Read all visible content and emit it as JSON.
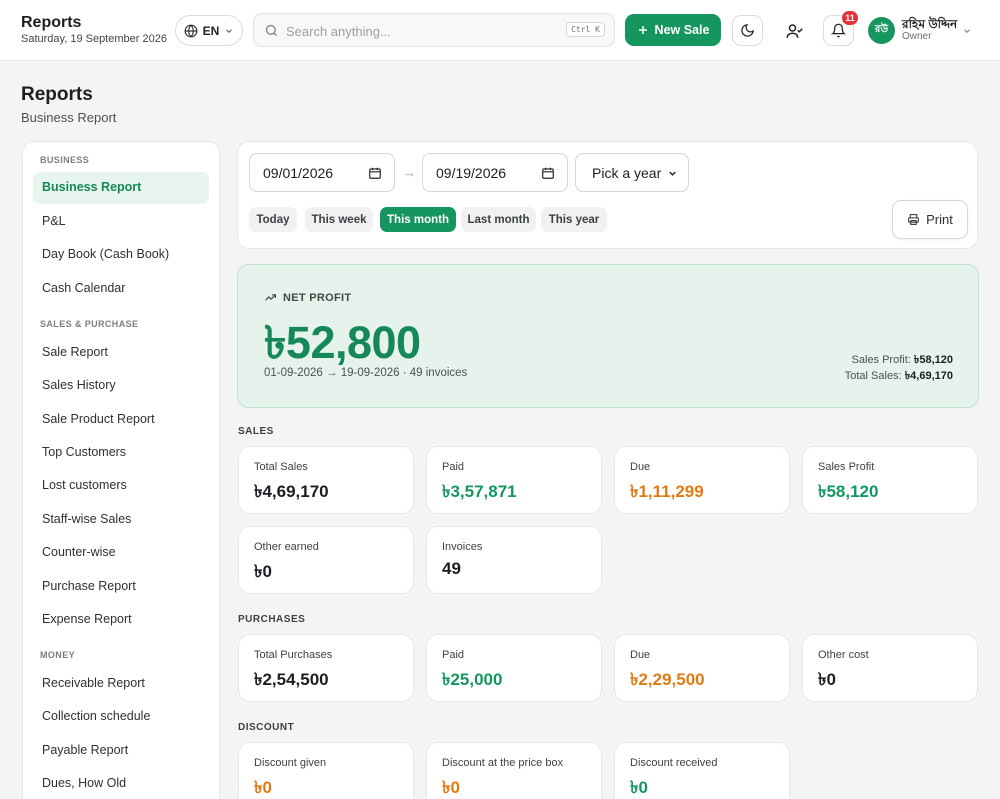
{
  "header": {
    "title": "Reports",
    "date": "Saturday, 19 September 2026",
    "language": "EN",
    "search_placeholder": "Search anything...",
    "search_shortcut": "Ctrl K",
    "new_sale_label": "New Sale",
    "notification_count": "11",
    "user_initials": "রউ",
    "user_name": "রহিম উদ্দিন",
    "user_role": "Owner"
  },
  "page": {
    "title": "Reports",
    "subtitle": "Business Report"
  },
  "sidebar": {
    "sections": [
      {
        "title": "BUSINESS",
        "items": [
          "Business Report",
          "P&L",
          "Day Book (Cash Book)",
          "Cash Calendar"
        ]
      },
      {
        "title": "SALES & PURCHASE",
        "items": [
          "Sale Report",
          "Sales History",
          "Sale Product Report",
          "Top Customers",
          "Lost customers",
          "Staff-wise Sales",
          "Counter-wise",
          "Purchase Report",
          "Expense Report"
        ]
      },
      {
        "title": "MONEY",
        "items": [
          "Receivable Report",
          "Collection schedule",
          "Payable Report",
          "Dues, How Old"
        ]
      }
    ],
    "active_item": "Business Report"
  },
  "filters": {
    "from_date": "09/01/2026",
    "to_date": "09/19/2026",
    "year_placeholder": "Pick a year",
    "presets": [
      "Today",
      "This week",
      "This month",
      "Last month",
      "This year"
    ],
    "active_preset": "This month",
    "print_label": "Print"
  },
  "net_profit": {
    "label": "NET PROFIT",
    "value": "৳52,800",
    "range": "01-09-2026 → 19-09-2026 · 49 invoices",
    "sales_profit_label": "Sales Profit:",
    "sales_profit_value": "৳58,120",
    "total_sales_label": "Total Sales:",
    "total_sales_value": "৳4,69,170"
  },
  "sales": {
    "title": "SALES",
    "cards": [
      {
        "label": "Total Sales",
        "value": "৳4,69,170",
        "tone": "dark"
      },
      {
        "label": "Paid",
        "value": "৳3,57,871",
        "tone": "green"
      },
      {
        "label": "Due",
        "value": "৳1,11,299",
        "tone": "orange"
      },
      {
        "label": "Sales Profit",
        "value": "৳58,120",
        "tone": "green"
      },
      {
        "label": "Other earned",
        "value": "৳0",
        "tone": "dark"
      },
      {
        "label": "Invoices",
        "value": "49",
        "tone": "dark"
      }
    ]
  },
  "purchases": {
    "title": "PURCHASES",
    "cards": [
      {
        "label": "Total Purchases",
        "value": "৳2,54,500",
        "tone": "dark"
      },
      {
        "label": "Paid",
        "value": "৳25,000",
        "tone": "green"
      },
      {
        "label": "Due",
        "value": "৳2,29,500",
        "tone": "orange"
      },
      {
        "label": "Other cost",
        "value": "৳0",
        "tone": "dark"
      }
    ]
  },
  "discount": {
    "title": "DISCOUNT",
    "cards": [
      {
        "label": "Discount given",
        "value": "৳0",
        "tone": "orange"
      },
      {
        "label": "Discount at the price box",
        "value": "৳0",
        "tone": "orange"
      },
      {
        "label": "Discount received",
        "value": "৳0",
        "tone": "green"
      }
    ]
  },
  "colors": {
    "brand": "#16965f",
    "brand_light": "#e5f3ec",
    "due_orange": "#e07b12",
    "badge_red": "#e5303a"
  },
  "icons": [
    "globe-icon",
    "chevron-down-icon",
    "search-icon",
    "plus-icon",
    "moon-icon",
    "user-icon",
    "bell-icon",
    "calendar-icon",
    "printer-icon",
    "trending-up-icon"
  ]
}
